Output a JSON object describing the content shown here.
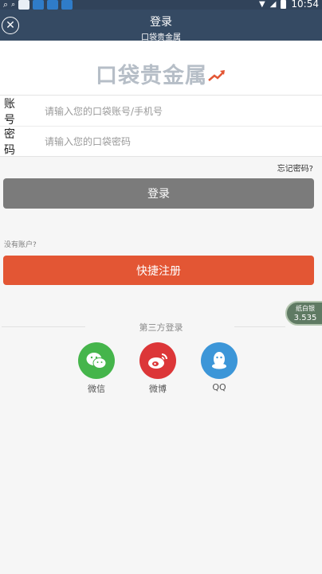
{
  "status_bar": {
    "time": "10:54"
  },
  "header": {
    "title": "登录",
    "subtitle": "口袋贵金属"
  },
  "logo": {
    "text": "口袋贵金属"
  },
  "form": {
    "account_label": "账号",
    "account_placeholder": "请输入您的口袋账号/手机号",
    "password_label": "密码",
    "password_placeholder": "请输入您的口袋密码",
    "forgot_password": "忘记密码?"
  },
  "login_button": "登录",
  "no_account": "没有账户?",
  "register_button": "快捷注册",
  "price_badge": {
    "label": "纸白银",
    "value": "3.535"
  },
  "third_party": {
    "title": "第三方登录",
    "options": [
      {
        "label": "微信",
        "icon": "wechat-icon",
        "color": "#45b54b"
      },
      {
        "label": "微博",
        "icon": "weibo-icon",
        "color": "#dc3638"
      },
      {
        "label": "QQ",
        "icon": "qq-icon",
        "color": "#3c96d8"
      }
    ]
  }
}
